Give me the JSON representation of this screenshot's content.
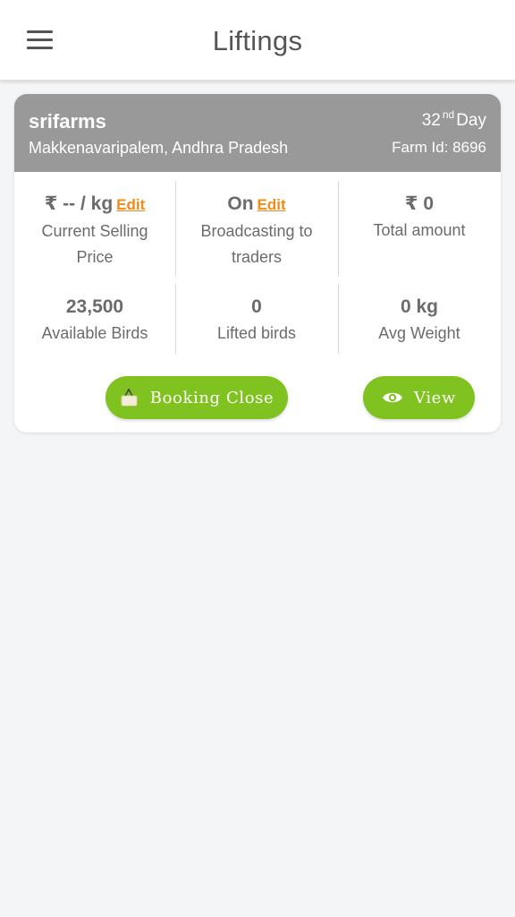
{
  "appbar": {
    "menu_icon": "hamburger-menu-icon",
    "title": "Liftings"
  },
  "farm": {
    "name": "srifarms",
    "location": "Makkenavaripalem, Andhra Pradesh",
    "day_number": "32",
    "day_suffix": "nd",
    "day_word": "Day",
    "farm_id_label": "Farm Id: 8696"
  },
  "stats": {
    "selling_price": {
      "value": "₹ -- / kg",
      "edit": "Edit",
      "label_line1": "Current Selling",
      "label_line2": "Price"
    },
    "broadcast": {
      "value": "On",
      "edit": "Edit",
      "label_line1": "Broadcasting to",
      "label_line2": "traders"
    },
    "total_amount": {
      "value": "₹ 0",
      "label": "Total amount"
    },
    "available_birds": {
      "value": "23,500",
      "label": "Available Birds"
    },
    "lifted_birds": {
      "value": "0",
      "label": "Lifted birds"
    },
    "avg_weight": {
      "value": "0 kg",
      "label": "Avg Weight"
    }
  },
  "actions": {
    "booking_close": {
      "label": "Booking Close",
      "icon": "closed-sign-icon"
    },
    "view": {
      "label": "View",
      "icon": "eye-icon"
    }
  },
  "colors": {
    "header_bg": "#999999",
    "button_green": "#80c21f",
    "edit_orange": "#f28a18"
  }
}
